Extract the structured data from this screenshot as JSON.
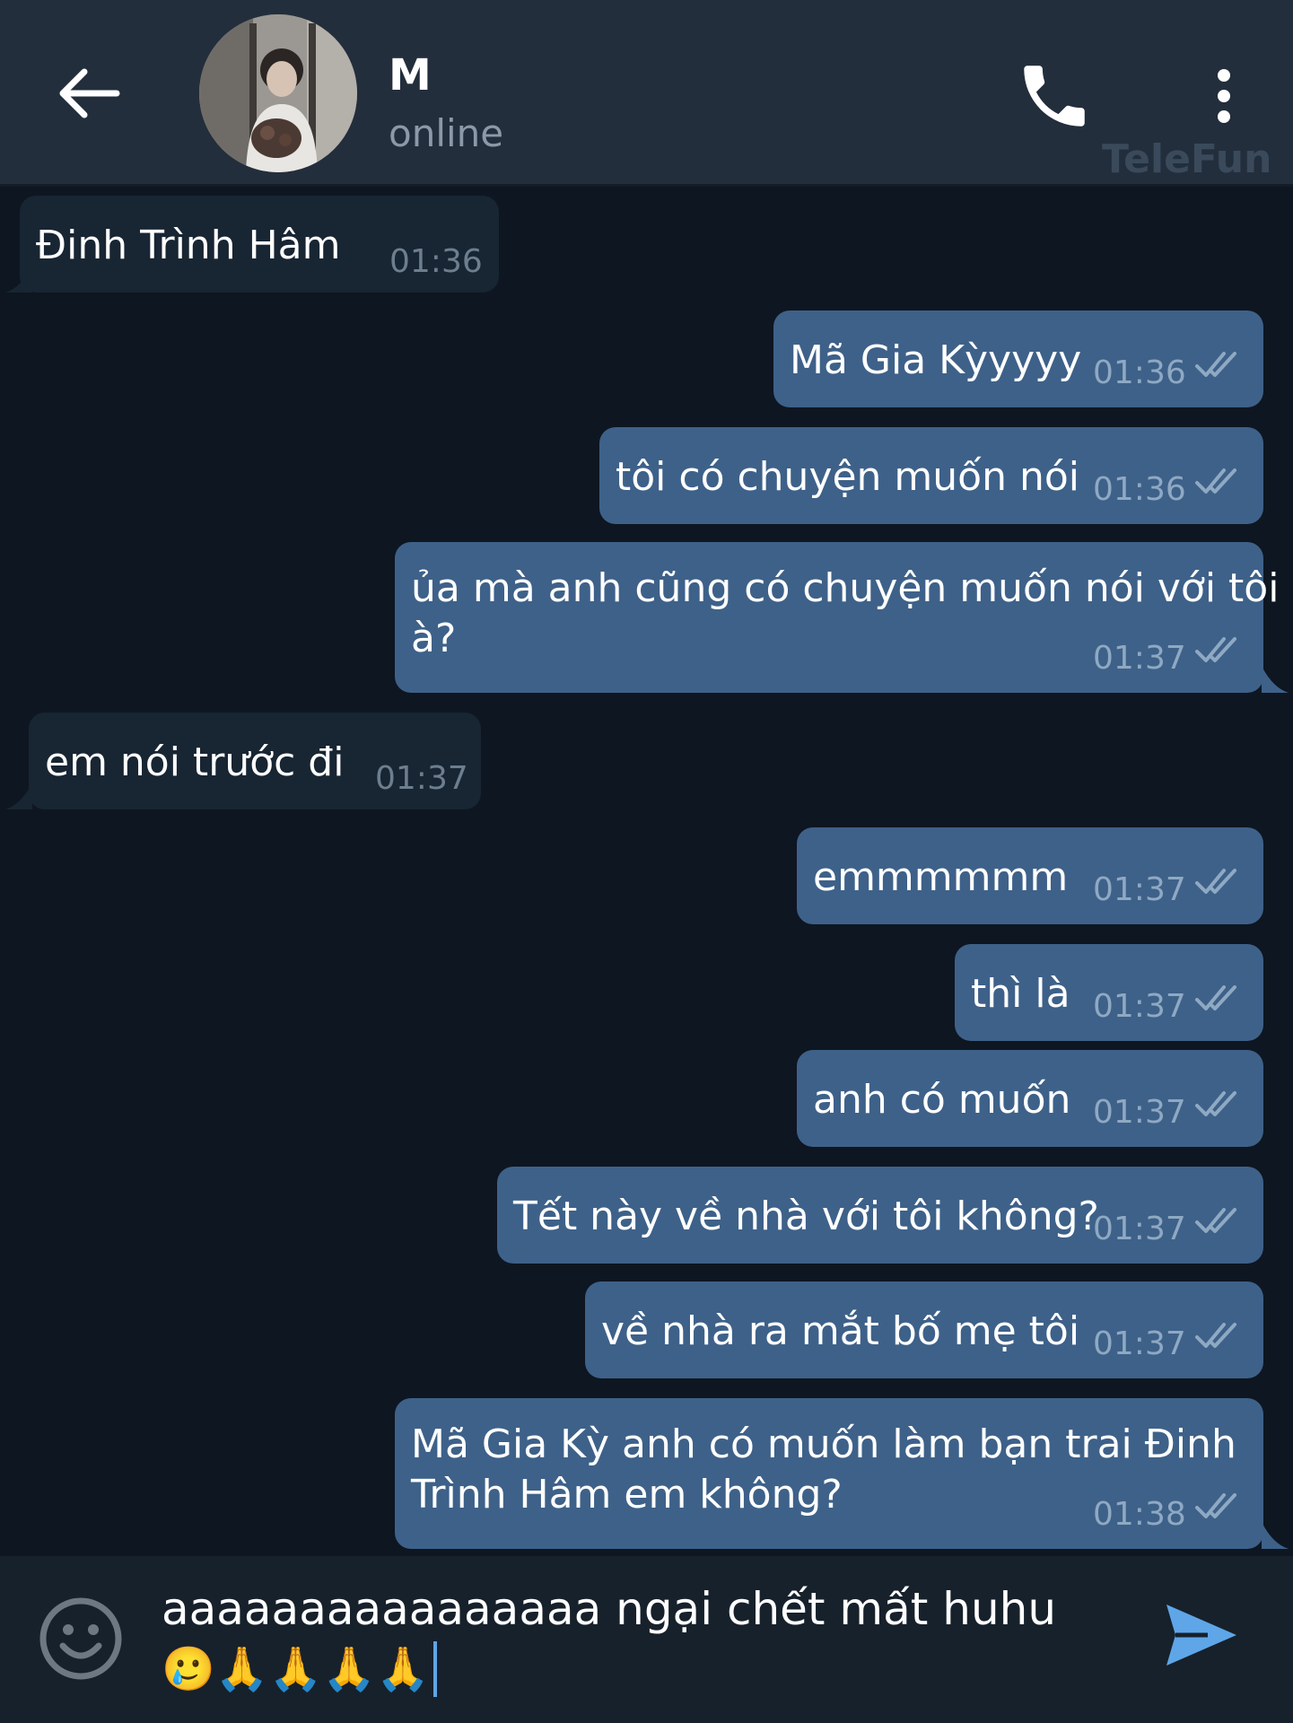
{
  "header": {
    "contact_name": "M",
    "status": "online",
    "watermark": "TeleFun",
    "icons": [
      "back-arrow-icon",
      "phone-icon",
      "more-vertical-icon"
    ]
  },
  "messages": [
    {
      "direction": "in",
      "text": "Đinh Trình Hâm",
      "time": "01:36"
    },
    {
      "direction": "out",
      "text": "Mã Gia Kỳyyyy",
      "time": "01:36",
      "read": true
    },
    {
      "direction": "out",
      "text": "tôi có chuyện muốn nói",
      "time": "01:36",
      "read": true
    },
    {
      "direction": "out",
      "text_line1": "ủa mà anh cũng có chuyện muốn nói với tôi",
      "text_line2": "à?",
      "time": "01:37",
      "read": true
    },
    {
      "direction": "in",
      "text": "em nói trước đi",
      "time": "01:37"
    },
    {
      "direction": "out",
      "text": "emmmmmm",
      "time": "01:37",
      "read": true
    },
    {
      "direction": "out",
      "text": "thì là",
      "time": "01:37",
      "read": true
    },
    {
      "direction": "out",
      "text": "anh có muốn",
      "time": "01:37",
      "read": true
    },
    {
      "direction": "out",
      "text": "Tết này về nhà với tôi không?",
      "time": "01:37",
      "read": true
    },
    {
      "direction": "out",
      "text": "về nhà ra mắt bố mẹ tôi",
      "time": "01:37",
      "read": true
    },
    {
      "direction": "out",
      "text_line1": "Mã Gia Kỳ anh có muốn làm bạn trai Đinh",
      "text_line2": "Trình Hâm em không?",
      "time": "01:38",
      "read": true
    }
  ],
  "composer": {
    "text": "aaaaaaaaaaaaaaaa ngại chết mất huhu",
    "emojis": "🥲🙏🙏🙏🙏",
    "icons": [
      "emoji-icon",
      "send-icon"
    ]
  },
  "colors": {
    "header_bg": "#232e3c",
    "chat_bg": "#0e1621",
    "incoming_bubble": "#182533",
    "outgoing_bubble": "#3e6189",
    "send_accent": "#5ea6e8"
  }
}
